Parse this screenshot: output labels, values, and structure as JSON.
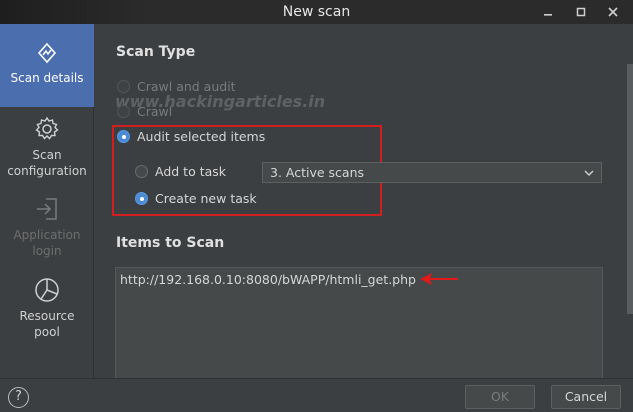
{
  "window": {
    "title": "New scan"
  },
  "sidebar": {
    "items": [
      {
        "label_line1": "Scan details",
        "label_line2": "",
        "icon": "burp-scan-icon",
        "active": true,
        "disabled": false
      },
      {
        "label_line1": "Scan",
        "label_line2": "configuration",
        "icon": "gear-icon",
        "active": false,
        "disabled": false
      },
      {
        "label_line1": "Application",
        "label_line2": "login",
        "icon": "login-icon",
        "active": false,
        "disabled": true
      },
      {
        "label_line1": "Resource",
        "label_line2": "pool",
        "icon": "pie-chart-icon",
        "active": false,
        "disabled": false
      }
    ]
  },
  "scan_type": {
    "title": "Scan Type",
    "options": {
      "crawl_and_audit": "Crawl and audit",
      "crawl": "Crawl",
      "audit_selected": "Audit selected items"
    },
    "selected": "audit_selected",
    "task": {
      "add_to_task_label": "Add to task",
      "create_new_task_label": "Create new task",
      "selected": "create_new_task",
      "task_dropdown_value": "3. Active scans"
    }
  },
  "items_to_scan": {
    "title": "Items to Scan",
    "items": [
      "http://192.168.0.10:8080/bWAPP/htmli_get.php"
    ]
  },
  "watermark": "www.hackingarticles.in",
  "footer": {
    "help_label": "?",
    "ok_label": "OK",
    "cancel_label": "Cancel"
  },
  "colors": {
    "accent": "#4b6eaf",
    "highlight": "#d11f1f",
    "background": "#3c3f41"
  }
}
